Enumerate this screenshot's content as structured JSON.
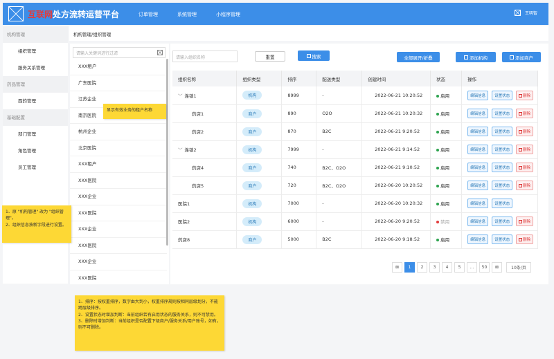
{
  "header": {
    "brand_strike": "互联网",
    "brand": "处方流转运营平台",
    "nav": [
      "订单管理",
      "系统管理",
      "小程序管理"
    ],
    "user": "王明智"
  },
  "sidebar": {
    "items": [
      {
        "type": "group",
        "label": "机构管理"
      },
      {
        "type": "item",
        "label": "组织管理"
      },
      {
        "type": "item",
        "label": "服务关系管理"
      },
      {
        "type": "group",
        "label": "药品管理"
      },
      {
        "type": "item",
        "label": "西药管理"
      },
      {
        "type": "group",
        "label": "基础配置"
      },
      {
        "type": "item",
        "label": "部门管理"
      },
      {
        "type": "item",
        "label": "角色管理"
      },
      {
        "type": "item",
        "label": "员工管理"
      }
    ]
  },
  "breadcrumb": "机构管理/组织管理",
  "tree": {
    "placeholder": "请输入关键词进行过滤",
    "items": [
      "XXX租户",
      "广东医院",
      "江苏企业",
      "南京医院",
      "杭州企业",
      "北京医院",
      "XXX租户",
      "XXX医院",
      "XXX企业",
      "XXX医院",
      "XXX企业",
      "XXX医院",
      "XXX企业",
      "XXX医院"
    ]
  },
  "toolbar": {
    "search_placeholder": "请输入组织名称",
    "reset": "重置",
    "search": "搜索",
    "expand_collapse": "全部展开/折叠",
    "add_org": "添加机构",
    "add_store": "添加商户"
  },
  "table": {
    "headers": [
      "组织名称",
      "组织类型",
      "排序",
      "配送类型",
      "创建时间",
      "状态",
      "操作"
    ],
    "rows": [
      {
        "name": "连锁1",
        "level": 0,
        "expandable": true,
        "type": "机构",
        "sort": "8999",
        "delivery": "-",
        "created": "2022-06-21  10:20:52",
        "status": "启用",
        "enabled": true,
        "actions": [
          "编辑信息",
          "设置状态",
          "删除"
        ]
      },
      {
        "name": "药店1",
        "level": 1,
        "expandable": false,
        "type": "商户",
        "sort": "890",
        "delivery": "O2O",
        "created": "2022-06-21  10:20:32",
        "status": "启用",
        "enabled": true,
        "actions": [
          "编辑信息",
          "设置状态",
          "删除"
        ]
      },
      {
        "name": "药店2",
        "level": 1,
        "expandable": false,
        "type": "商户",
        "sort": "870",
        "delivery": "B2C",
        "created": "2022-06-21  9:20:52",
        "status": "启用",
        "enabled": true,
        "actions": [
          "编辑信息",
          "设置状态",
          "删除"
        ]
      },
      {
        "name": "连锁2",
        "level": 0,
        "expandable": true,
        "type": "机构",
        "sort": "7999",
        "delivery": "-",
        "created": "2022-06-21  9:14:52",
        "status": "启用",
        "enabled": true,
        "actions": [
          "编辑信息",
          "设置状态",
          "删除"
        ]
      },
      {
        "name": "药店4",
        "level": 1,
        "expandable": false,
        "type": "商户",
        "sort": "740",
        "delivery": "B2C、O2O",
        "created": "2022-06-21  9:10:52",
        "status": "启用",
        "enabled": true,
        "actions": [
          "编辑信息",
          "设置状态",
          "删除"
        ]
      },
      {
        "name": "药店5",
        "level": 1,
        "expandable": false,
        "type": "商户",
        "sort": "720",
        "delivery": "B2C、O2O",
        "created": "2022-06-20  10:20:52",
        "status": "启用",
        "enabled": true,
        "actions": [
          "编辑信息",
          "设置状态",
          "删除"
        ]
      },
      {
        "name": "医院1",
        "level": 0,
        "expandable": false,
        "type": "机构",
        "sort": "7000",
        "delivery": "-",
        "created": "2022-06-20  10:20:32",
        "status": "启用",
        "enabled": true,
        "actions": [
          "编辑信息",
          "设置状态"
        ]
      },
      {
        "name": "医院2",
        "level": 0,
        "expandable": false,
        "type": "机构",
        "sort": "6000",
        "delivery": "-",
        "created": "2022-06-20  9:20:52",
        "status": "禁用",
        "enabled": false,
        "actions": [
          "编辑信息",
          "设置状态",
          "删除"
        ]
      },
      {
        "name": "药店8",
        "level": 0,
        "expandable": false,
        "type": "商户",
        "sort": "5000",
        "delivery": "B2C",
        "created": "2022-06-20  9:18:52",
        "status": "启用",
        "enabled": true,
        "actions": [
          "编辑信息",
          "设置状态",
          "删除"
        ]
      }
    ]
  },
  "pager": {
    "pages": [
      "1",
      "2",
      "3",
      "4",
      "5",
      "...",
      "50"
    ],
    "current": "1",
    "size": "10条/页"
  },
  "notes": {
    "tree_hint": "显示有效业务的租户名称",
    "rename": [
      "1、原 \"机构管理\" 改为 \"组织管理\"。",
      "2、组织信息按新字段进行设置。"
    ],
    "rules": [
      "1、排序：按权重排序，数字由大到小，权重排序规则按相同层级划分，不能跨层级排序。",
      "2、设置状态时增加判断：当前组织若有启用状态的服务关系，则不可禁用。",
      "3、删除时增加判断：当前组织是否配置下级商户/服务关系/用户账号，如有，则不可删除。"
    ]
  },
  "colors": {
    "primary": "#3c8ee8",
    "enabled": "#2ea44f",
    "disabled": "#e23c3c",
    "note": "#fdd835"
  }
}
